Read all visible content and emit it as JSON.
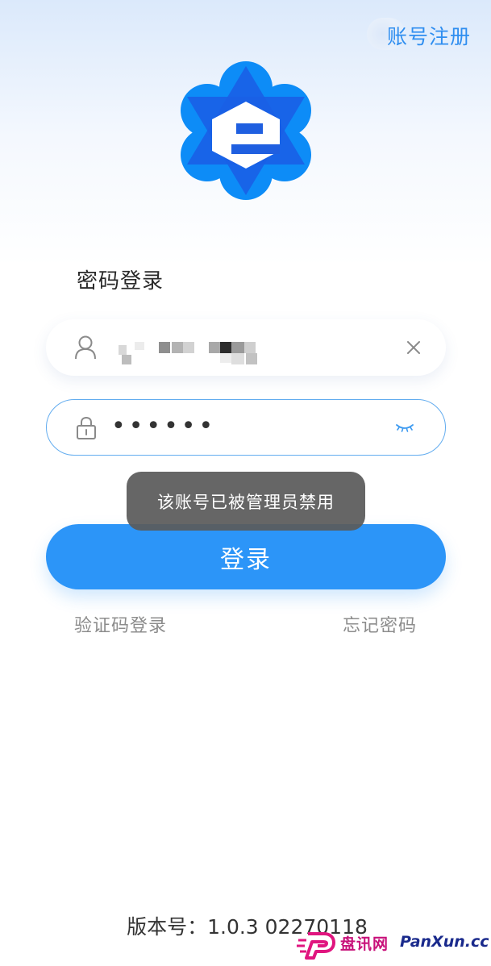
{
  "header": {
    "register_label": "账号注册"
  },
  "login": {
    "title": "密码登录",
    "username_value": "",
    "password_dots": "••••••",
    "button_label": "登录"
  },
  "toast": {
    "message": "该账号已被管理员禁用"
  },
  "links": {
    "sms_login": "验证码登录",
    "forgot_password": "忘记密码"
  },
  "footer": {
    "version": "版本号：1.0.3 02270118"
  },
  "watermark": {
    "cn": "盘讯网",
    "en": "PanXun.cc"
  },
  "colors": {
    "accent": "#2c95f8",
    "link": "#2f8ef0",
    "toast_bg": "#5a5a5a",
    "muted": "#8c8c8c"
  },
  "icons": {
    "user": "user-icon",
    "lock": "lock-icon",
    "clear": "close-icon",
    "visibility": "eye-closed-icon",
    "logo": "app-logo-icon"
  }
}
